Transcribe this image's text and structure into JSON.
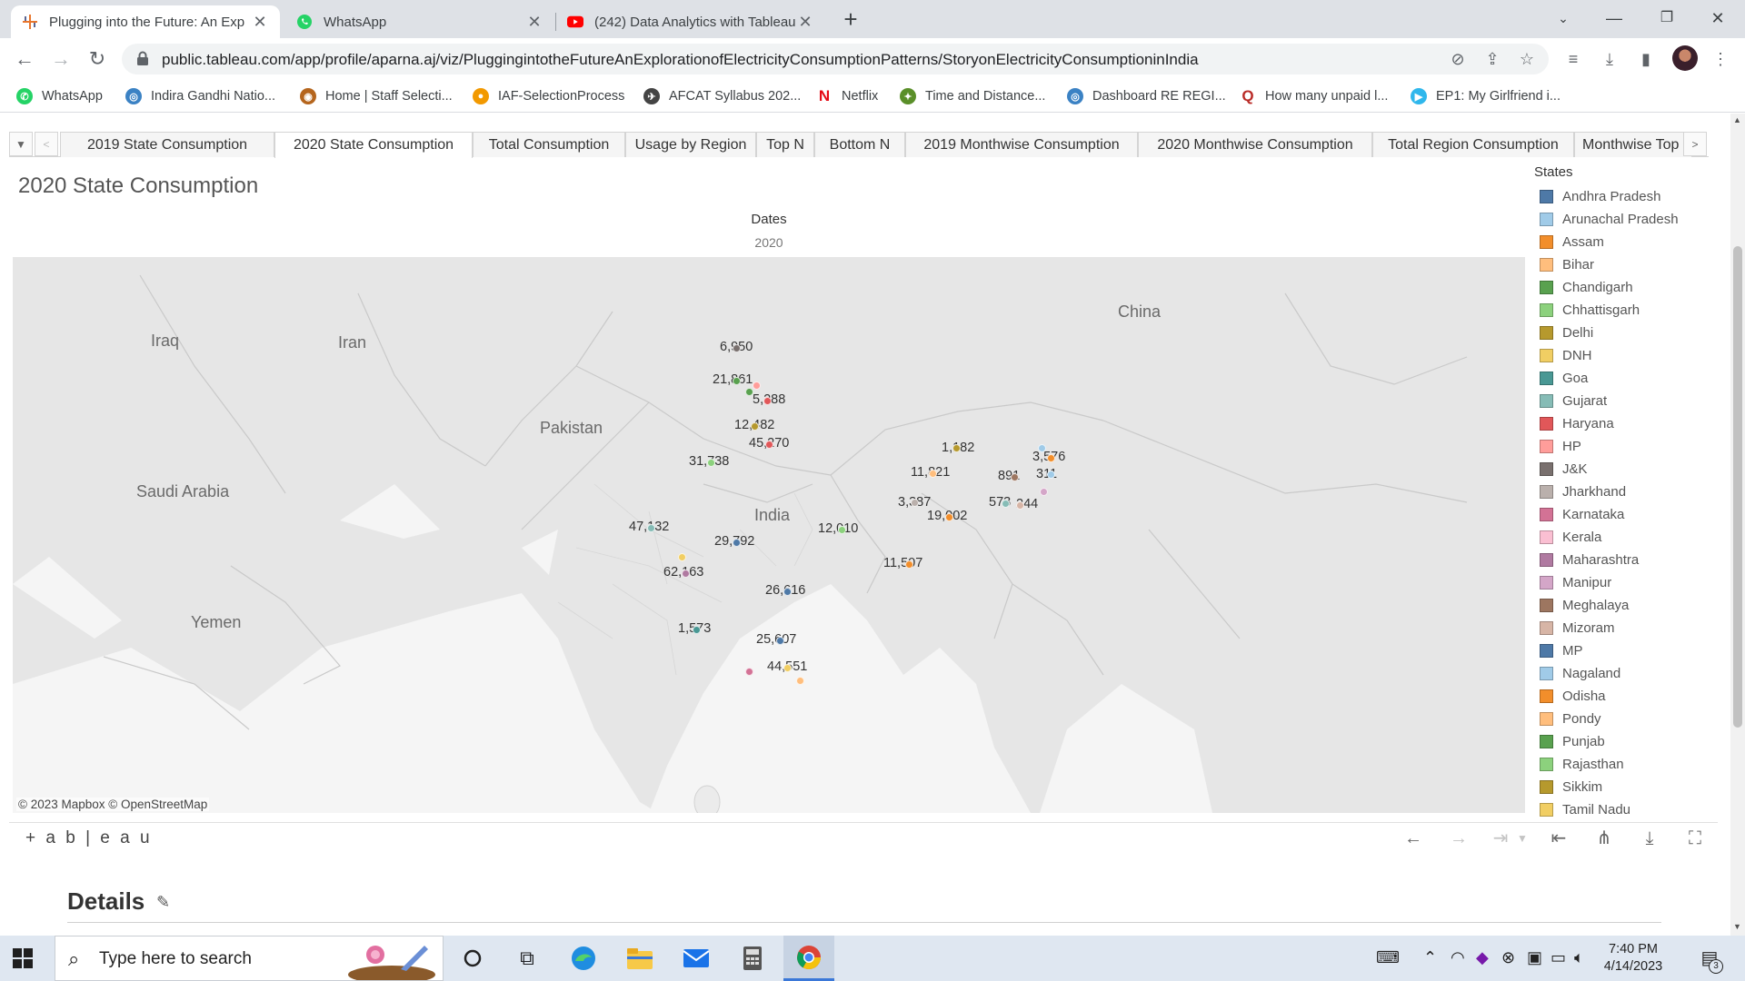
{
  "browser": {
    "tabs": [
      {
        "title": "Plugging into the Future: An Exp",
        "icon": "tableau-icon",
        "active": true
      },
      {
        "title": "WhatsApp",
        "icon": "whatsapp-icon",
        "active": false
      },
      {
        "title": "(242) Data Analytics with Tableau",
        "icon": "youtube-icon",
        "active": false
      }
    ],
    "url": "public.tableau.com/app/profile/aparna.aj/viz/PluggingintotheFutureAnExplorationofElectricityConsumptionPatterns/StoryonElectricityConsumptioninIndia",
    "bookmarks": [
      {
        "label": "WhatsApp",
        "color": "#25d366"
      },
      {
        "label": "Indira Gandhi Natio...",
        "color": "#3b82c4"
      },
      {
        "label": "Home | Staff Selecti...",
        "color": "#b5651d"
      },
      {
        "label": "IAF-SelectionProcess",
        "color": "#f29900"
      },
      {
        "label": "AFCAT Syllabus 202...",
        "color": "#444444"
      },
      {
        "label": "Netflix",
        "color": "#e50914"
      },
      {
        "label": "Time and Distance...",
        "color": "#5a8f29"
      },
      {
        "label": "Dashboard RE REGI...",
        "color": "#3b82c4"
      },
      {
        "label": "How many unpaid l...",
        "color": "#b92b27"
      },
      {
        "label": "EP1: My Girlfriend i...",
        "color": "#2fb7ec"
      }
    ]
  },
  "story": {
    "tabs": [
      "2019 State Consumption",
      "2020 State Consumption",
      "Total Consumption",
      "Usage by Region",
      "Top N",
      "Bottom N",
      "2019 Monthwise Consumption",
      "2020 Monthwise Consumption",
      "Total Region Consumption",
      "Monthwise Top C"
    ],
    "active_tab": "2020 State Consumption"
  },
  "viz": {
    "title": "2020 State Consumption",
    "column_header": "Dates",
    "column_value": "2020",
    "attribution": "© 2023 Mapbox  © OpenStreetMap",
    "country_labels": [
      "Iraq",
      "Iran",
      "Pakistan",
      "China",
      "Saudi Arabia",
      "India",
      "Yemen"
    ],
    "data_labels": [
      "6,950",
      "21,861",
      "5,288",
      "12,482",
      "45,270",
      "31,738",
      "1,182",
      "3,576",
      "11,821",
      "891",
      "311",
      "3,387",
      "573",
      "244",
      "19,002",
      "47,132",
      "29,792",
      "12,010",
      "62,163",
      "11,507",
      "26,616",
      "1,573",
      "25,607",
      "44,551"
    ]
  },
  "legend": {
    "title": "States",
    "items": [
      {
        "label": "Andhra Pradesh",
        "color": "#4e79a7"
      },
      {
        "label": "Arunachal Pradesh",
        "color": "#a0cbe8"
      },
      {
        "label": "Assam",
        "color": "#f28e2b"
      },
      {
        "label": "Bihar",
        "color": "#ffbe7d"
      },
      {
        "label": "Chandigarh",
        "color": "#59a14f"
      },
      {
        "label": "Chhattisgarh",
        "color": "#8cd17d"
      },
      {
        "label": "Delhi",
        "color": "#b6992d"
      },
      {
        "label": "DNH",
        "color": "#f1ce63"
      },
      {
        "label": "Goa",
        "color": "#499894"
      },
      {
        "label": "Gujarat",
        "color": "#86bcb6"
      },
      {
        "label": "Haryana",
        "color": "#e15759"
      },
      {
        "label": "HP",
        "color": "#ff9d9a"
      },
      {
        "label": "J&K",
        "color": "#79706e"
      },
      {
        "label": "Jharkhand",
        "color": "#bab0ac"
      },
      {
        "label": "Karnataka",
        "color": "#d37295"
      },
      {
        "label": "Kerala",
        "color": "#fabfd2"
      },
      {
        "label": "Maharashtra",
        "color": "#b07aa1"
      },
      {
        "label": "Manipur",
        "color": "#d4a6c8"
      },
      {
        "label": "Meghalaya",
        "color": "#9d7660"
      },
      {
        "label": "Mizoram",
        "color": "#d7b5a6"
      },
      {
        "label": "MP",
        "color": "#4e79a7"
      },
      {
        "label": "Nagaland",
        "color": "#a0cbe8"
      },
      {
        "label": "Odisha",
        "color": "#f28e2b"
      },
      {
        "label": "Pondy",
        "color": "#ffbe7d"
      },
      {
        "label": "Punjab",
        "color": "#59a14f"
      },
      {
        "label": "Rajasthan",
        "color": "#8cd17d"
      },
      {
        "label": "Sikkim",
        "color": "#b6992d"
      },
      {
        "label": "Tamil Nadu",
        "color": "#f1ce63"
      }
    ]
  },
  "footer": {
    "brand": "+ a b | e a u",
    "details_heading": "Details"
  },
  "taskbar": {
    "search_placeholder": "Type here to search",
    "time": "7:40 PM",
    "date": "4/14/2023",
    "notifications": "3"
  }
}
